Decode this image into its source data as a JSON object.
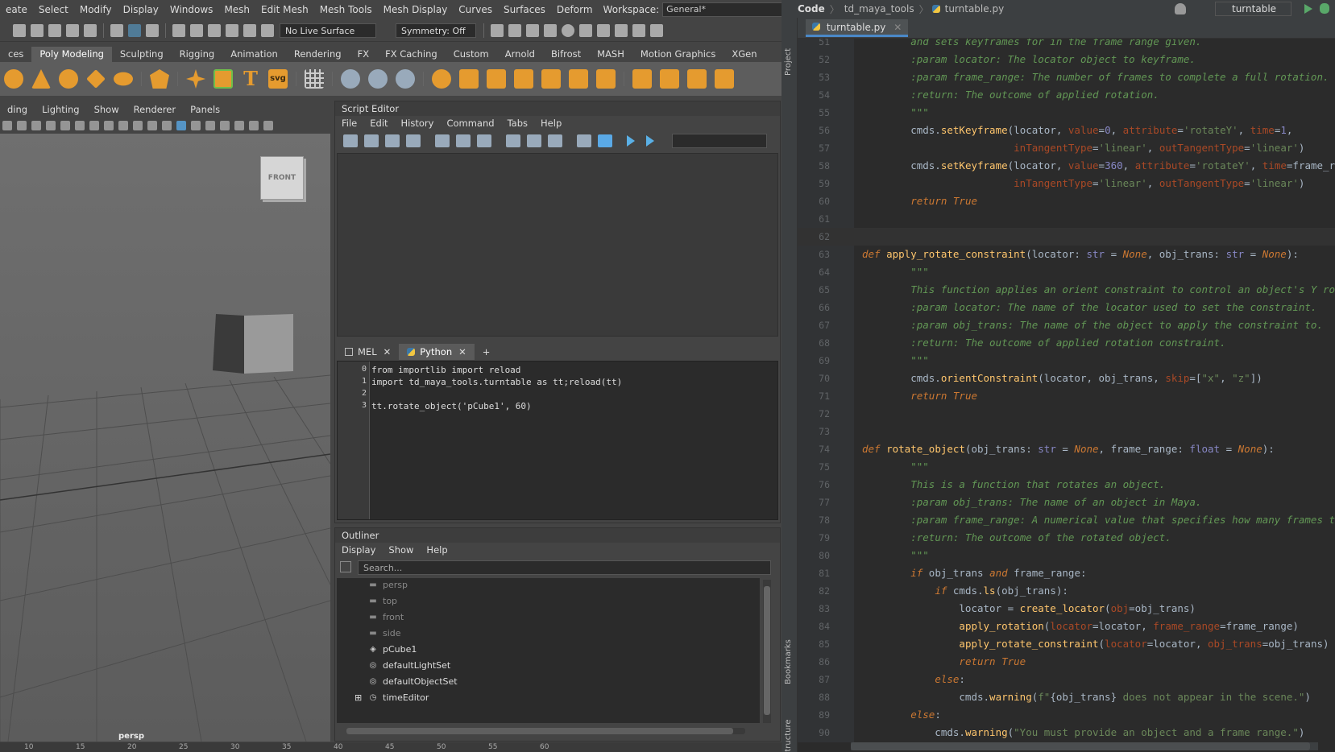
{
  "maya": {
    "menus": [
      "eate",
      "Select",
      "Modify",
      "Display",
      "Windows",
      "Mesh",
      "Edit Mesh",
      "Mesh Tools",
      "Mesh Display",
      "Curves",
      "Surfaces",
      "Deform"
    ],
    "workspace_label": "Workspace:",
    "workspace_value": "General*",
    "live_surface": "No Live Surface",
    "symmetry": "Symmetry: Off",
    "shelf_tabs": [
      "ces",
      "Poly Modeling",
      "Sculpting",
      "Rigging",
      "Animation",
      "Rendering",
      "FX",
      "FX Caching",
      "Custom",
      "Arnold",
      "Bifrost",
      "MASH",
      "Motion Graphics",
      "XGen"
    ],
    "active_shelf": "Poly Modeling",
    "viewport_menus": [
      "ding",
      "Lighting",
      "Show",
      "Renderer",
      "Panels"
    ],
    "viewcube_label": "FRONT",
    "camera_label": "persp",
    "timeline_ticks": [
      "10",
      "15",
      "20",
      "25",
      "30",
      "35",
      "40",
      "45",
      "50",
      "55",
      "60"
    ]
  },
  "script_editor": {
    "title": "Script Editor",
    "menus": [
      "File",
      "Edit",
      "History",
      "Command",
      "Tabs",
      "Help"
    ],
    "tabs": [
      {
        "label": "MEL"
      },
      {
        "label": "Python"
      }
    ],
    "add_tab": "+",
    "lines": [
      {
        "num": "0",
        "text": "from importlib import reload"
      },
      {
        "num": "1",
        "text": "import td_maya_tools.turntable as tt;reload(tt)"
      },
      {
        "num": "2",
        "text": ""
      },
      {
        "num": "3",
        "text": "tt.rotate_object('pCube1', 60)"
      }
    ]
  },
  "outliner": {
    "title": "Outliner",
    "menus": [
      "Display",
      "Show",
      "Help"
    ],
    "search_placeholder": "Search...",
    "items": [
      {
        "label": "persp",
        "icon": "camera-icon",
        "dim": true
      },
      {
        "label": "top",
        "icon": "camera-icon",
        "dim": true
      },
      {
        "label": "front",
        "icon": "camera-icon",
        "dim": true
      },
      {
        "label": "side",
        "icon": "camera-icon",
        "dim": true
      },
      {
        "label": "pCube1",
        "icon": "mesh-icon",
        "dim": false
      },
      {
        "label": "defaultLightSet",
        "icon": "set-icon",
        "dim": false
      },
      {
        "label": "defaultObjectSet",
        "icon": "set-icon",
        "dim": false
      },
      {
        "label": "timeEditor",
        "icon": "clock-icon",
        "dim": false
      }
    ]
  },
  "ide": {
    "breadcrumbs": [
      "Code",
      "td_maya_tools",
      "turntable.py"
    ],
    "run_config": "turntable",
    "file_tab": "turntable.py",
    "side_labels": [
      "Project",
      "Bookmarks",
      "Structure"
    ],
    "current_line": "62",
    "code": [
      {
        "n": "51",
        "h": "        <span class='cm'>and sets keyframes for in the frame range given.</span>"
      },
      {
        "n": "52",
        "h": "        <span class='cm'><i>:param</i> locator: The locator object to keyframe.</span>"
      },
      {
        "n": "53",
        "h": "        <span class='cm'><i>:param</i> frame_range: The number of frames to complete a full rotation.</span>"
      },
      {
        "n": "54",
        "h": "        <span class='cm'><i>:return</i>: The outcome of applied rotation.</span>"
      },
      {
        "n": "55",
        "h": "        <span class='cm'>\"\"\"</span>"
      },
      {
        "n": "56",
        "h": "        cmds.<span class='fn'>setKeyframe</span>(locator, <span class='pa'>value</span>=<span class='bi'>0</span>, <span class='pa'>attribute</span>=<span class='st2'>'rotateY'</span>, <span class='pa'>time</span>=<span class='bi'>1</span>,"
      },
      {
        "n": "57",
        "h": "                         <span class='pa'>inTangentType</span>=<span class='st2'>'linear'</span>, <span class='pa'>outTangentType</span>=<span class='st2'>'linear'</span>)"
      },
      {
        "n": "58",
        "h": "        cmds.<span class='fn'>setKeyframe</span>(locator, <span class='pa'>value</span>=<span class='bi'>360</span>, <span class='pa'>attribute</span>=<span class='st2'>'rotateY'</span>, <span class='pa'>time</span>=frame_ra"
      },
      {
        "n": "59",
        "h": "                         <span class='pa'>inTangentType</span>=<span class='st2'>'linear'</span>, <span class='pa'>outTangentType</span>=<span class='st2'>'linear'</span>)"
      },
      {
        "n": "60",
        "h": "        <span class='kw'>return True</span>"
      },
      {
        "n": "61",
        "h": ""
      },
      {
        "n": "62",
        "h": ""
      },
      {
        "n": "63",
        "h": "<span class='kw'>def</span> <span class='fn'>apply_rotate_constraint</span>(locator: <span class='bi'>str</span> = <span class='kw'>None</span>, obj_trans: <span class='bi'>str</span> = <span class='kw'>None</span>):"
      },
      {
        "n": "64",
        "h": "        <span class='cm'>\"\"\"</span>"
      },
      {
        "n": "65",
        "h": "        <span class='cm'>This function applies an orient constraint to control an object's Y rot</span>"
      },
      {
        "n": "66",
        "h": "        <span class='cm'><i>:param</i> locator: The name of the locator used to set the constraint.</span>"
      },
      {
        "n": "67",
        "h": "        <span class='cm'><i>:param</i> obj_trans: The name of the object to apply the constraint to.</span>"
      },
      {
        "n": "68",
        "h": "        <span class='cm'><i>:return</i>: The outcome of applied rotation constraint.</span>"
      },
      {
        "n": "69",
        "h": "        <span class='cm'>\"\"\"</span>"
      },
      {
        "n": "70",
        "h": "        cmds.<span class='fn'>orientConstraint</span>(locator, obj_trans, <span class='pa'>skip</span>=[<span class='st2'>\"x\"</span>, <span class='st2'>\"z\"</span>])"
      },
      {
        "n": "71",
        "h": "        <span class='kw'>return True</span>"
      },
      {
        "n": "72",
        "h": ""
      },
      {
        "n": "73",
        "h": ""
      },
      {
        "n": "74",
        "h": "<span class='kw'>def</span> <span class='fn'>rotate_object</span>(obj_trans: <span class='bi'>str</span> = <span class='kw'>None</span>, frame_range: <span class='bi'>float</span> = <span class='kw'>None</span>):"
      },
      {
        "n": "75",
        "h": "        <span class='cm'>\"\"\"</span>"
      },
      {
        "n": "76",
        "h": "        <span class='cm'>This is a function that rotates an object.</span>"
      },
      {
        "n": "77",
        "h": "        <span class='cm'><i>:param</i> obj_trans: The name of an object in Maya.</span>"
      },
      {
        "n": "78",
        "h": "        <span class='cm'><i>:param</i> frame_range: A numerical value that specifies how many frames to</span>"
      },
      {
        "n": "79",
        "h": "        <span class='cm'><i>:return</i>: The outcome of the rotated object.</span>"
      },
      {
        "n": "80",
        "h": "        <span class='cm'>\"\"\"</span>"
      },
      {
        "n": "81",
        "h": "        <span class='kw'>if</span> obj_trans <span class='kw'>and</span> frame_range:"
      },
      {
        "n": "82",
        "h": "            <span class='kw'>if</span> cmds.<span class='fn'>ls</span>(obj_trans):"
      },
      {
        "n": "83",
        "h": "                locator = <span class='fn'>create_locator</span>(<span class='pa'>obj</span>=obj_trans)"
      },
      {
        "n": "84",
        "h": "                <span class='fn'>apply_rotation</span>(<span class='pa'>locator</span>=locator, <span class='pa'>frame_range</span>=frame_range)"
      },
      {
        "n": "85",
        "h": "                <span class='fn'>apply_rotate_constraint</span>(<span class='pa'>locator</span>=locator, <span class='pa'>obj_trans</span>=obj_trans)"
      },
      {
        "n": "86",
        "h": "                <span class='kw'>return True</span>"
      },
      {
        "n": "87",
        "h": "            <span class='kw'>else</span>:"
      },
      {
        "n": "88",
        "h": "                cmds.<span class='fn'>warning</span>(<span class='st2'>f\"</span>{obj_trans}<span class='st2'> does not appear in the scene.\"</span>)"
      },
      {
        "n": "89",
        "h": "        <span class='kw'>else</span>:"
      },
      {
        "n": "90",
        "h": "            cmds.<span class='fn'>warning</span>(<span class='st2'>\"You must provide an object and a frame range.\"</span>)"
      }
    ]
  }
}
